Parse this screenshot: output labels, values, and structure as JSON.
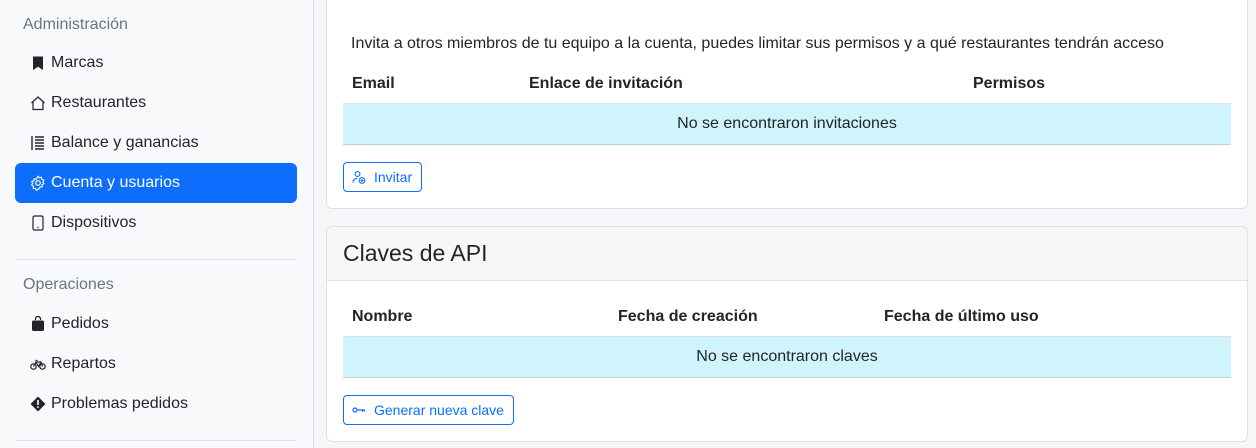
{
  "sidebar": {
    "sections": [
      {
        "title": "Administración",
        "items": [
          {
            "label": "Marcas",
            "icon": "bookmark-icon"
          },
          {
            "label": "Restaurantes",
            "icon": "house-icon"
          },
          {
            "label": "Balance y ganancias",
            "icon": "receipt-icon"
          },
          {
            "label": "Cuenta y usuarios",
            "icon": "gear-icon",
            "active": true
          },
          {
            "label": "Dispositivos",
            "icon": "tablet-icon"
          }
        ]
      },
      {
        "title": "Operaciones",
        "items": [
          {
            "label": "Pedidos",
            "icon": "bag-icon"
          },
          {
            "label": "Repartos",
            "icon": "bicycle-icon"
          },
          {
            "label": "Problemas pedidos",
            "icon": "warning-diamond-icon"
          }
        ]
      }
    ]
  },
  "invitations": {
    "intro": "Invita a otros miembros de tu equipo a la cuenta, puedes limitar sus permisos y a qué restaurantes tendrán acceso",
    "columns": [
      "Email",
      "Enlace de invitación",
      "Permisos"
    ],
    "empty": "No se encontraron invitaciones",
    "invite_button": "Invitar"
  },
  "api_keys": {
    "title": "Claves de API",
    "columns": [
      "Nombre",
      "Fecha de creación",
      "Fecha de último uso"
    ],
    "empty": "No se encontraron claves",
    "generate_button": "Generar nueva clave"
  },
  "colors": {
    "primary": "#0d6efd",
    "info_row": "#cff4fc",
    "sidebar_bg": "#f8f9fa"
  }
}
